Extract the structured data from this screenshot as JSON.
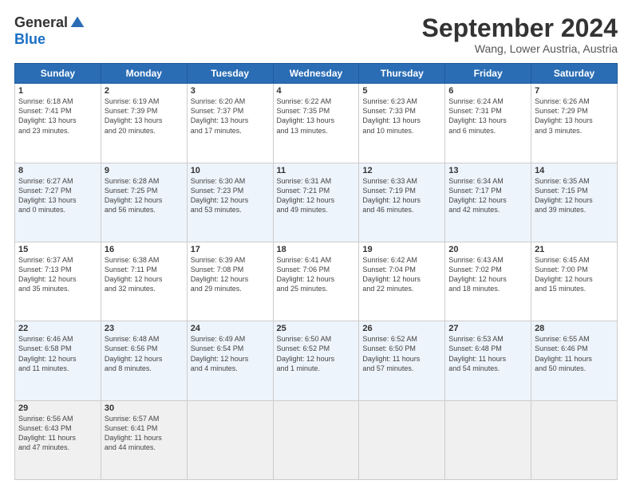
{
  "logo": {
    "general": "General",
    "blue": "Blue"
  },
  "header": {
    "month": "September 2024",
    "location": "Wang, Lower Austria, Austria"
  },
  "weekdays": [
    "Sunday",
    "Monday",
    "Tuesday",
    "Wednesday",
    "Thursday",
    "Friday",
    "Saturday"
  ],
  "weeks": [
    [
      {
        "day": "1",
        "lines": [
          "Sunrise: 6:18 AM",
          "Sunset: 7:41 PM",
          "Daylight: 13 hours",
          "and 23 minutes."
        ]
      },
      {
        "day": "2",
        "lines": [
          "Sunrise: 6:19 AM",
          "Sunset: 7:39 PM",
          "Daylight: 13 hours",
          "and 20 minutes."
        ]
      },
      {
        "day": "3",
        "lines": [
          "Sunrise: 6:20 AM",
          "Sunset: 7:37 PM",
          "Daylight: 13 hours",
          "and 17 minutes."
        ]
      },
      {
        "day": "4",
        "lines": [
          "Sunrise: 6:22 AM",
          "Sunset: 7:35 PM",
          "Daylight: 13 hours",
          "and 13 minutes."
        ]
      },
      {
        "day": "5",
        "lines": [
          "Sunrise: 6:23 AM",
          "Sunset: 7:33 PM",
          "Daylight: 13 hours",
          "and 10 minutes."
        ]
      },
      {
        "day": "6",
        "lines": [
          "Sunrise: 6:24 AM",
          "Sunset: 7:31 PM",
          "Daylight: 13 hours",
          "and 6 minutes."
        ]
      },
      {
        "day": "7",
        "lines": [
          "Sunrise: 6:26 AM",
          "Sunset: 7:29 PM",
          "Daylight: 13 hours",
          "and 3 minutes."
        ]
      }
    ],
    [
      {
        "day": "8",
        "lines": [
          "Sunrise: 6:27 AM",
          "Sunset: 7:27 PM",
          "Daylight: 13 hours",
          "and 0 minutes."
        ]
      },
      {
        "day": "9",
        "lines": [
          "Sunrise: 6:28 AM",
          "Sunset: 7:25 PM",
          "Daylight: 12 hours",
          "and 56 minutes."
        ]
      },
      {
        "day": "10",
        "lines": [
          "Sunrise: 6:30 AM",
          "Sunset: 7:23 PM",
          "Daylight: 12 hours",
          "and 53 minutes."
        ]
      },
      {
        "day": "11",
        "lines": [
          "Sunrise: 6:31 AM",
          "Sunset: 7:21 PM",
          "Daylight: 12 hours",
          "and 49 minutes."
        ]
      },
      {
        "day": "12",
        "lines": [
          "Sunrise: 6:33 AM",
          "Sunset: 7:19 PM",
          "Daylight: 12 hours",
          "and 46 minutes."
        ]
      },
      {
        "day": "13",
        "lines": [
          "Sunrise: 6:34 AM",
          "Sunset: 7:17 PM",
          "Daylight: 12 hours",
          "and 42 minutes."
        ]
      },
      {
        "day": "14",
        "lines": [
          "Sunrise: 6:35 AM",
          "Sunset: 7:15 PM",
          "Daylight: 12 hours",
          "and 39 minutes."
        ]
      }
    ],
    [
      {
        "day": "15",
        "lines": [
          "Sunrise: 6:37 AM",
          "Sunset: 7:13 PM",
          "Daylight: 12 hours",
          "and 35 minutes."
        ]
      },
      {
        "day": "16",
        "lines": [
          "Sunrise: 6:38 AM",
          "Sunset: 7:11 PM",
          "Daylight: 12 hours",
          "and 32 minutes."
        ]
      },
      {
        "day": "17",
        "lines": [
          "Sunrise: 6:39 AM",
          "Sunset: 7:08 PM",
          "Daylight: 12 hours",
          "and 29 minutes."
        ]
      },
      {
        "day": "18",
        "lines": [
          "Sunrise: 6:41 AM",
          "Sunset: 7:06 PM",
          "Daylight: 12 hours",
          "and 25 minutes."
        ]
      },
      {
        "day": "19",
        "lines": [
          "Sunrise: 6:42 AM",
          "Sunset: 7:04 PM",
          "Daylight: 12 hours",
          "and 22 minutes."
        ]
      },
      {
        "day": "20",
        "lines": [
          "Sunrise: 6:43 AM",
          "Sunset: 7:02 PM",
          "Daylight: 12 hours",
          "and 18 minutes."
        ]
      },
      {
        "day": "21",
        "lines": [
          "Sunrise: 6:45 AM",
          "Sunset: 7:00 PM",
          "Daylight: 12 hours",
          "and 15 minutes."
        ]
      }
    ],
    [
      {
        "day": "22",
        "lines": [
          "Sunrise: 6:46 AM",
          "Sunset: 6:58 PM",
          "Daylight: 12 hours",
          "and 11 minutes."
        ]
      },
      {
        "day": "23",
        "lines": [
          "Sunrise: 6:48 AM",
          "Sunset: 6:56 PM",
          "Daylight: 12 hours",
          "and 8 minutes."
        ]
      },
      {
        "day": "24",
        "lines": [
          "Sunrise: 6:49 AM",
          "Sunset: 6:54 PM",
          "Daylight: 12 hours",
          "and 4 minutes."
        ]
      },
      {
        "day": "25",
        "lines": [
          "Sunrise: 6:50 AM",
          "Sunset: 6:52 PM",
          "Daylight: 12 hours",
          "and 1 minute."
        ]
      },
      {
        "day": "26",
        "lines": [
          "Sunrise: 6:52 AM",
          "Sunset: 6:50 PM",
          "Daylight: 11 hours",
          "and 57 minutes."
        ]
      },
      {
        "day": "27",
        "lines": [
          "Sunrise: 6:53 AM",
          "Sunset: 6:48 PM",
          "Daylight: 11 hours",
          "and 54 minutes."
        ]
      },
      {
        "day": "28",
        "lines": [
          "Sunrise: 6:55 AM",
          "Sunset: 6:46 PM",
          "Daylight: 11 hours",
          "and 50 minutes."
        ]
      }
    ],
    [
      {
        "day": "29",
        "lines": [
          "Sunrise: 6:56 AM",
          "Sunset: 6:43 PM",
          "Daylight: 11 hours",
          "and 47 minutes."
        ]
      },
      {
        "day": "30",
        "lines": [
          "Sunrise: 6:57 AM",
          "Sunset: 6:41 PM",
          "Daylight: 11 hours",
          "and 44 minutes."
        ]
      },
      null,
      null,
      null,
      null,
      null
    ]
  ]
}
